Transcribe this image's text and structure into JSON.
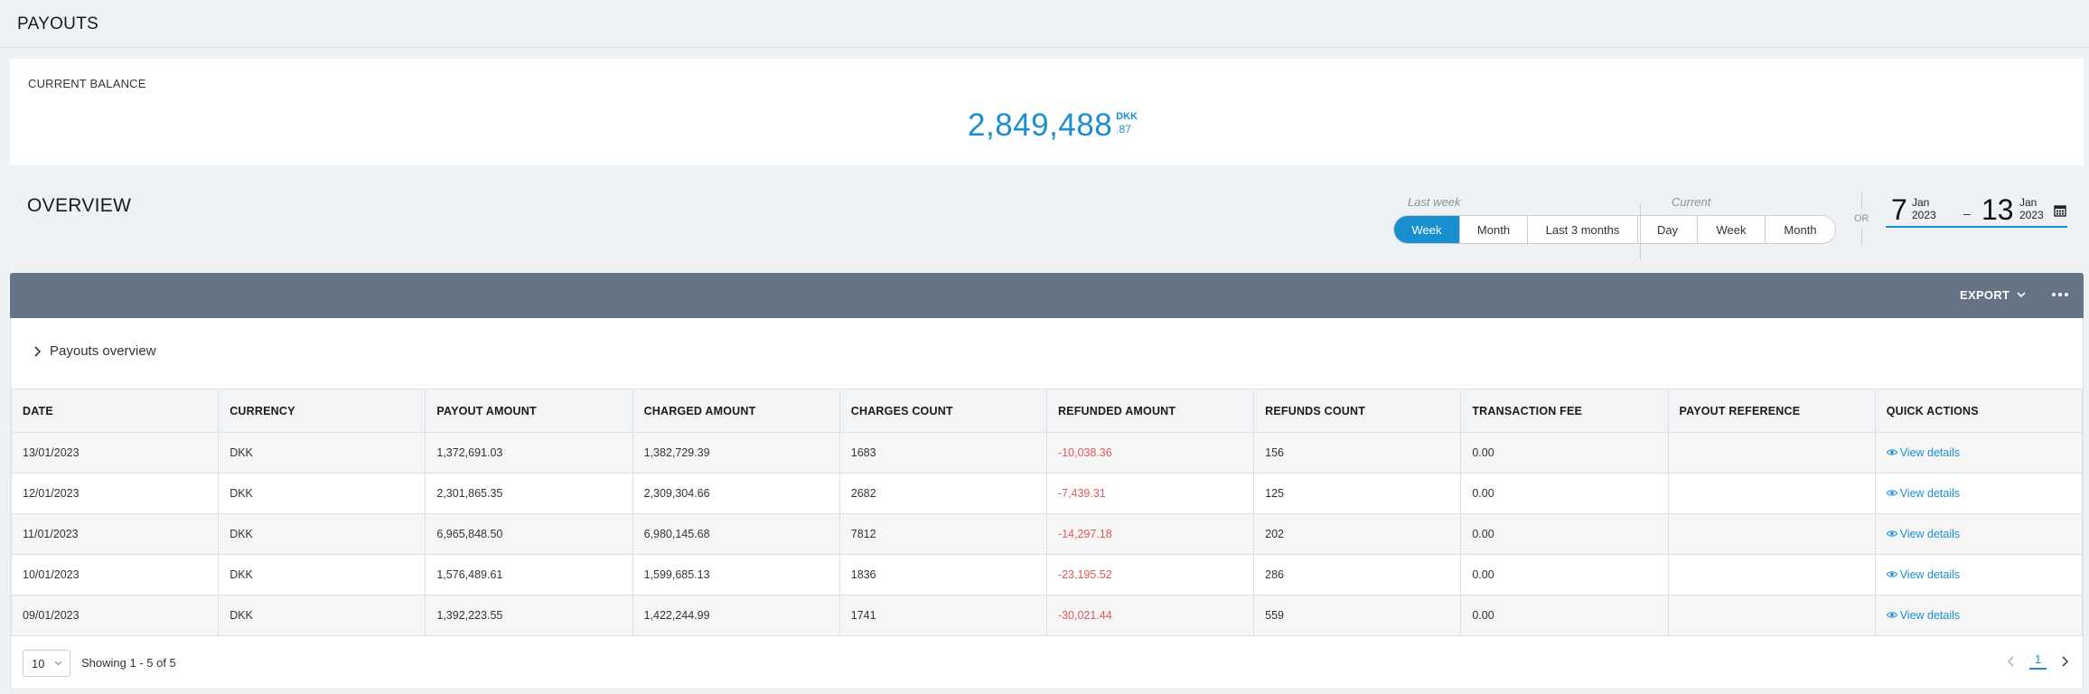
{
  "header": {
    "title": "PAYOUTS"
  },
  "balance": {
    "label": "CURRENT BALANCE",
    "amount": "2,849,488",
    "currency": "DKK",
    "decimals": ".87"
  },
  "overview": {
    "title": "OVERVIEW",
    "last_week_label": "Last week",
    "current_label": "Current",
    "last_week_buttons": [
      "Week",
      "Month",
      "Last 3 months"
    ],
    "current_buttons": [
      "Day",
      "Week",
      "Month"
    ],
    "active_button": "Week",
    "or_label": "OR",
    "date_from": {
      "day": "7",
      "month": "Jan",
      "year": "2023"
    },
    "date_sep": "–",
    "date_to": {
      "day": "13",
      "month": "Jan",
      "year": "2023"
    }
  },
  "toolbar": {
    "export_label": "EXPORT"
  },
  "payouts_overview_label": "Payouts overview",
  "table": {
    "columns": [
      "DATE",
      "CURRENCY",
      "PAYOUT AMOUNT",
      "CHARGED AMOUNT",
      "CHARGES COUNT",
      "REFUNDED AMOUNT",
      "REFUNDS COUNT",
      "TRANSACTION FEE",
      "PAYOUT REFERENCE",
      "QUICK ACTIONS"
    ],
    "rows": [
      [
        "13/01/2023",
        "DKK",
        "1,372,691.03",
        "1,382,729.39",
        "1683",
        "-10,038.36",
        "156",
        "0.00",
        "",
        "View details"
      ],
      [
        "12/01/2023",
        "DKK",
        "2,301,865.35",
        "2,309,304.66",
        "2682",
        "-7,439.31",
        "125",
        "0.00",
        "",
        "View details"
      ],
      [
        "11/01/2023",
        "DKK",
        "6,965,848.50",
        "6,980,145.68",
        "7812",
        "-14,297.18",
        "202",
        "0.00",
        "",
        "View details"
      ],
      [
        "10/01/2023",
        "DKK",
        "1,576,489.61",
        "1,599,685.13",
        "1836",
        "-23,195.52",
        "286",
        "0.00",
        "",
        "View details"
      ],
      [
        "09/01/2023",
        "DKK",
        "1,392,223.55",
        "1,422,244.99",
        "1741",
        "-30,021.44",
        "559",
        "0.00",
        "",
        "View details"
      ]
    ]
  },
  "footer": {
    "page_size": "10",
    "showing": "Showing 1 - 5 of 5",
    "current_page": "1"
  },
  "colors": {
    "accent": "#1a8fd0",
    "toolbar": "#647386",
    "negative": "#e05a5a"
  }
}
